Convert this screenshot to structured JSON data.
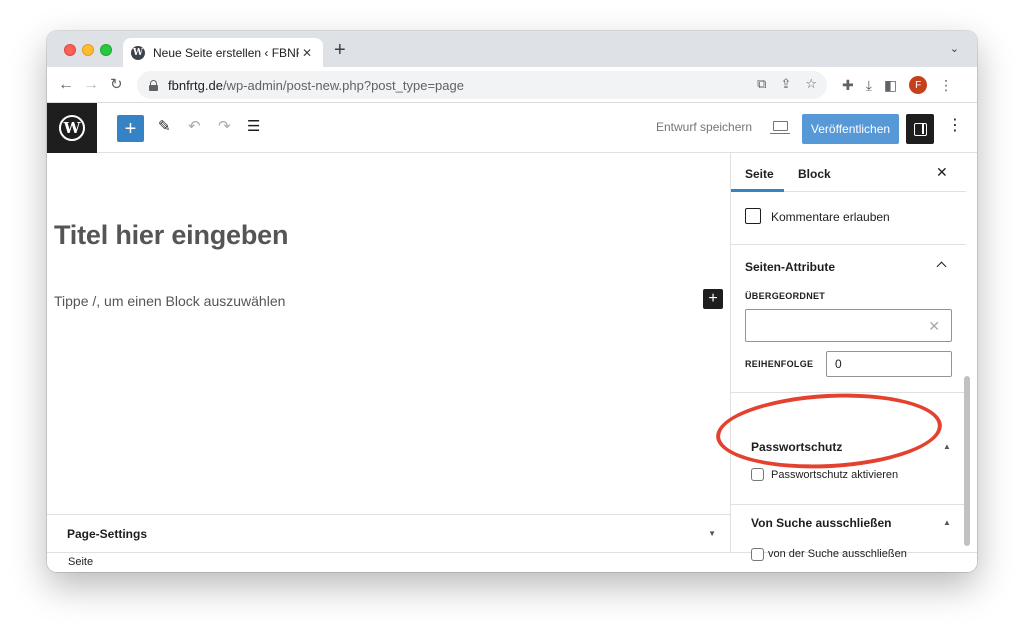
{
  "browser": {
    "tab_title": "Neue Seite erstellen ‹ FBNFRT",
    "tab_close": "✕",
    "new_tab": "+",
    "tab_dropdown": "⌄",
    "url_host": "fbnfrtg.de",
    "url_path": "/wp-admin/post-new.php?post_type=page",
    "avatar_letter": "F",
    "icons": [
      "back-icon",
      "forward-icon",
      "reload-icon",
      "lock-icon",
      "share-icon",
      "install-icon",
      "star-icon",
      "extensions-icon",
      "download-icon",
      "sidepanel-icon",
      "kebab-menu-icon"
    ]
  },
  "editor_header": {
    "inserter_label": "+",
    "save_draft": "Entwurf speichern",
    "publish": "Veröffentlichen",
    "more": "⋮",
    "colors": {
      "publish_bg": "#5798d6",
      "inserter_bg": "#3582c4",
      "logo_bg": "#1e1e1e"
    }
  },
  "canvas": {
    "title_placeholder": "Titel hier eingeben",
    "block_placeholder": "Tippe /, um einen Block auszuwählen",
    "block_add": "+"
  },
  "meta_box": {
    "label": "Page-Settings",
    "caret": "▼"
  },
  "footer": {
    "breadcrumb": "Seite"
  },
  "sidebar": {
    "tabs": [
      {
        "label": "Seite",
        "active": true
      },
      {
        "label": "Block",
        "active": false
      }
    ],
    "close": "✕",
    "comments_label": "Kommentare erlauben",
    "attributes": {
      "title": "Seiten-Attribute",
      "parent_label": "ÜBERGEORDNET",
      "parent_value": "",
      "parent_clear": "✕",
      "order_label": "REIHENFOLGE",
      "order_value": "0"
    },
    "password": {
      "title": "Passwortschutz",
      "toggle": "▲",
      "checkbox_label": "Passwortschutz aktivieren"
    },
    "search": {
      "title": "Von Suche ausschließen",
      "toggle": "▲",
      "checkbox_label": "von der Suche ausschließen"
    }
  },
  "annotation": {
    "highlight_color": "#e4412f"
  }
}
